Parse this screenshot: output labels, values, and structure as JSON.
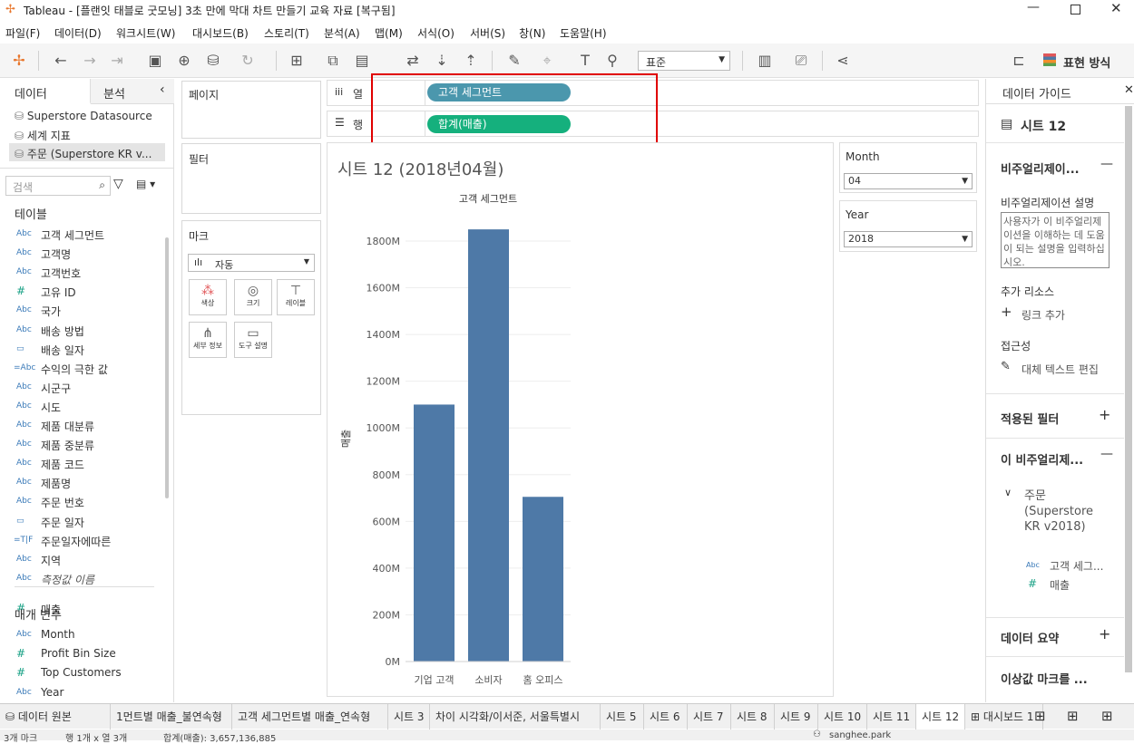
{
  "window": {
    "title": "Tableau - [플랜잇 태블로 굿모닝] 3초 만에 막대 차트 만들기 교육 자료 [복구됨]"
  },
  "menu": [
    "파일(F)",
    "데이터(D)",
    "워크시트(W)",
    "대시보드(B)",
    "스토리(T)",
    "분석(A)",
    "맵(M)",
    "서식(O)",
    "서버(S)",
    "창(N)",
    "도움말(H)"
  ],
  "toolbar": {
    "fit_select": "표준",
    "show_me": "표현 방식"
  },
  "left_pane": {
    "tab_data": "데이터",
    "tab_analysis": "분석",
    "datasources": [
      "Superstore Datasource",
      "세계 지표",
      "주문 (Superstore KR v..."
    ],
    "search_placeholder": "검색",
    "tables_header": "테이블",
    "fields": [
      {
        "type": "Abc",
        "name": "고객 세그먼트"
      },
      {
        "type": "Abc",
        "name": "고객명"
      },
      {
        "type": "Abc",
        "name": "고객번호"
      },
      {
        "type": "#",
        "name": "고유 ID"
      },
      {
        "type": "Abc",
        "name": "국가"
      },
      {
        "type": "Abc",
        "name": "배송 방법"
      },
      {
        "type": "date",
        "name": "배송 일자"
      },
      {
        "type": "=Abc",
        "name": "수익의 극한 값"
      },
      {
        "type": "Abc",
        "name": "시군구"
      },
      {
        "type": "Abc",
        "name": "시도"
      },
      {
        "type": "Abc",
        "name": "제품 대분류"
      },
      {
        "type": "Abc",
        "name": "제품 중분류"
      },
      {
        "type": "Abc",
        "name": "제품 코드"
      },
      {
        "type": "Abc",
        "name": "제품명"
      },
      {
        "type": "Abc",
        "name": "주문 번호"
      },
      {
        "type": "date",
        "name": "주문 일자"
      },
      {
        "type": "=T|F",
        "name": "주문일자에따른"
      },
      {
        "type": "Abc",
        "name": "지역"
      },
      {
        "type": "Abc",
        "name": "측정값 이름"
      },
      {
        "type": "#",
        "name": "매출"
      }
    ],
    "params_header": "매개 변수",
    "params": [
      {
        "type": "Abc",
        "name": "Month"
      },
      {
        "type": "#",
        "name": "Profit Bin Size"
      },
      {
        "type": "#",
        "name": "Top Customers"
      },
      {
        "type": "Abc",
        "name": "Year"
      }
    ]
  },
  "cards": {
    "pages": "페이지",
    "filters": "필터",
    "marks": "마크",
    "marks_type": "자동",
    "mark_buttons": [
      "색상",
      "크기",
      "레이블",
      "세부 정보",
      "도구 설명"
    ]
  },
  "shelves": {
    "columns_label": "열",
    "rows_label": "행",
    "columns_pill": "고객 세그먼트",
    "rows_pill": "합계(매출)"
  },
  "sheet": {
    "title": "시트 12 (2018년04월)"
  },
  "filters": {
    "month_label": "Month",
    "month_value": "04",
    "year_label": "Year",
    "year_value": "2018"
  },
  "chart_data": {
    "type": "bar",
    "title": "고객 세그먼트",
    "categories": [
      "기업 고객",
      "소비자",
      "홈 오피스"
    ],
    "values": [
      1100,
      1850,
      705
    ],
    "ylabel": "매출",
    "yticks": [
      "0M",
      "200M",
      "400M",
      "600M",
      "800M",
      "1000M",
      "1200M",
      "1400M",
      "1600M",
      "1800M"
    ],
    "ylim": [
      0,
      1900
    ],
    "bar_color": "#4e79a7"
  },
  "right_pane": {
    "header": "데이터 가이드",
    "sheet_name": "시트 12",
    "viz_section": "비주얼리제이...",
    "viz_desc_label": "비주얼리제이션 설명",
    "viz_desc_placeholder": "사용자가 이 비주얼리제이션을 이해하는 데 도움이 되는 설명을 입력하십시오.",
    "extra_resources": "추가 리소스",
    "add_link": "링크 추가",
    "accessibility": "접근성",
    "alt_text": "대체 텍스트 편집",
    "applied_filters": "적용된 필터",
    "this_viz": "이 비주얼리제...",
    "source": "주문 (Superstore KR v2018)",
    "source_fields": [
      "고객 세그...",
      "매출"
    ],
    "data_summary": "데이터 요약",
    "outlier": "이상값 마크를 ..."
  },
  "tabs": [
    "데이터 원본",
    "1먼트별 매출_불연속형",
    "고객 세그먼트별 매출_연속형",
    "시트 3",
    "차이 시각화/이서준, 서울특별시",
    "시트 5",
    "시트 6",
    "시트 7",
    "시트 8",
    "시트 9",
    "시트 10",
    "시트 11",
    "시트 12",
    "대시보드 1"
  ],
  "status": {
    "marks": "3개 마크",
    "rows_cols": "행 1개 x 열 3개",
    "sum": "합계(매출): 3,657,136,885",
    "user": "sanghee.park"
  },
  "colors": {
    "columns_pill": "#4b97ad",
    "rows_pill": "#15b07d",
    "highlight": "#e00000"
  }
}
